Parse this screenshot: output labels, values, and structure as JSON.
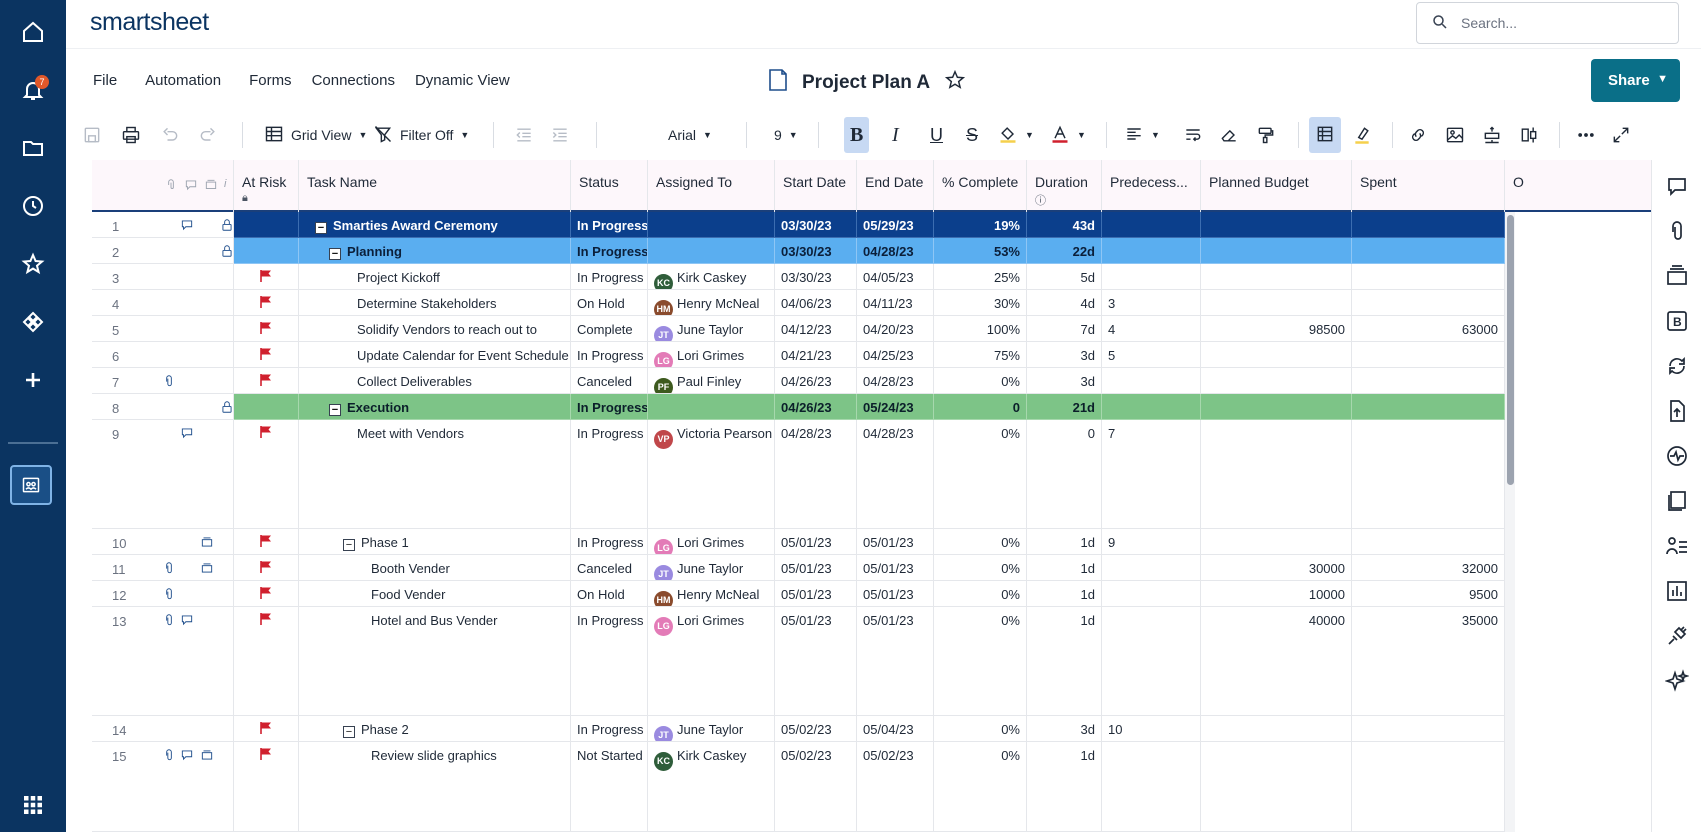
{
  "app": {
    "logo": "smartsheet",
    "notification_count": "7"
  },
  "search": {
    "placeholder": "Search..."
  },
  "menu": {
    "file": "File",
    "automation": "Automation",
    "forms": "Forms",
    "connections": "Connections",
    "dynamic_view": "Dynamic View"
  },
  "sheet": {
    "title": "Project Plan A"
  },
  "share": {
    "label": "Share"
  },
  "toolbar": {
    "view": "Grid View",
    "filter": "Filter Off",
    "font": "Arial",
    "font_size": "9"
  },
  "columns": {
    "at_risk": "At Risk",
    "task_name": "Task Name",
    "status": "Status",
    "assigned_to": "Assigned To",
    "start_date": "Start Date",
    "end_date": "End Date",
    "pct_complete": "% Complete",
    "duration": "Duration",
    "predecessors": "Predecess...",
    "planned_budget": "Planned Budget",
    "spent": "Spent",
    "overflow": "O"
  },
  "rows": [
    {
      "num": "1",
      "name": "Smarties Award Ceremony",
      "status": "In Progress",
      "assignee": "",
      "initials": "",
      "start": "03/30/23",
      "end": "05/29/23",
      "pct": "19%",
      "dur": "43d",
      "pred": "",
      "budget": "",
      "spent": ""
    },
    {
      "num": "2",
      "name": "Planning",
      "status": "In Progress",
      "assignee": "",
      "initials": "",
      "start": "03/30/23",
      "end": "04/28/23",
      "pct": "53%",
      "dur": "22d",
      "pred": "",
      "budget": "",
      "spent": ""
    },
    {
      "num": "3",
      "name": "Project Kickoff",
      "status": "In Progress",
      "assignee": "Kirk Caskey",
      "initials": "KC",
      "start": "03/30/23",
      "end": "04/05/23",
      "pct": "25%",
      "dur": "5d",
      "pred": "",
      "budget": "",
      "spent": ""
    },
    {
      "num": "4",
      "name": "Determine Stakeholders",
      "status": "On Hold",
      "assignee": "Henry McNeal",
      "initials": "HM",
      "start": "04/06/23",
      "end": "04/11/23",
      "pct": "30%",
      "dur": "4d",
      "pred": "3",
      "budget": "",
      "spent": ""
    },
    {
      "num": "5",
      "name": "Solidify Vendors to reach out to",
      "status": "Complete",
      "assignee": "June Taylor",
      "initials": "JT",
      "start": "04/12/23",
      "end": "04/20/23",
      "pct": "100%",
      "dur": "7d",
      "pred": "4",
      "budget": "98500",
      "spent": "63000"
    },
    {
      "num": "6",
      "name": "Update Calendar for Event Schedule",
      "status": "In Progress",
      "assignee": "Lori Grimes",
      "initials": "LG",
      "start": "04/21/23",
      "end": "04/25/23",
      "pct": "75%",
      "dur": "3d",
      "pred": "5",
      "budget": "",
      "spent": ""
    },
    {
      "num": "7",
      "name": "Collect Deliverables",
      "status": "Canceled",
      "assignee": "Paul Finley",
      "initials": "PF",
      "start": "04/26/23",
      "end": "04/28/23",
      "pct": "0%",
      "dur": "3d",
      "pred": "",
      "budget": "",
      "spent": ""
    },
    {
      "num": "8",
      "name": "Execution",
      "status": "In Progress",
      "assignee": "",
      "initials": "",
      "start": "04/26/23",
      "end": "05/24/23",
      "pct": "0",
      "dur": "21d",
      "pred": "",
      "budget": "",
      "spent": ""
    },
    {
      "num": "9",
      "name": "Meet with Vendors",
      "status": "In Progress",
      "assignee": "Victoria Pearson",
      "initials": "VP",
      "start": "04/28/23",
      "end": "04/28/23",
      "pct": "0%",
      "dur": "0",
      "pred": "7",
      "budget": "",
      "spent": ""
    },
    {
      "num": "10",
      "name": "Phase 1",
      "status": "In Progress",
      "assignee": "Lori Grimes",
      "initials": "LG",
      "start": "05/01/23",
      "end": "05/01/23",
      "pct": "0%",
      "dur": "1d",
      "pred": "9",
      "budget": "",
      "spent": ""
    },
    {
      "num": "11",
      "name": "Booth Vender",
      "status": "Canceled",
      "assignee": "June Taylor",
      "initials": "JT",
      "start": "05/01/23",
      "end": "05/01/23",
      "pct": "0%",
      "dur": "1d",
      "pred": "",
      "budget": "30000",
      "spent": "32000"
    },
    {
      "num": "12",
      "name": "Food Vender",
      "status": "On Hold",
      "assignee": "Henry McNeal",
      "initials": "HM",
      "start": "05/01/23",
      "end": "05/01/23",
      "pct": "0%",
      "dur": "1d",
      "pred": "",
      "budget": "10000",
      "spent": "9500"
    },
    {
      "num": "13",
      "name": "Hotel and Bus Vender",
      "status": "In Progress",
      "assignee": "Lori Grimes",
      "initials": "LG",
      "start": "05/01/23",
      "end": "05/01/23",
      "pct": "0%",
      "dur": "1d",
      "pred": "",
      "budget": "40000",
      "spent": "35000"
    },
    {
      "num": "14",
      "name": "Phase 2",
      "status": "In Progress",
      "assignee": "June Taylor",
      "initials": "JT",
      "start": "05/02/23",
      "end": "05/04/23",
      "pct": "0%",
      "dur": "3d",
      "pred": "10",
      "budget": "",
      "spent": ""
    },
    {
      "num": "15",
      "name": "Review slide graphics",
      "status": "Not Started",
      "assignee": "Kirk Caskey",
      "initials": "KC",
      "start": "05/02/23",
      "end": "05/02/23",
      "pct": "0%",
      "dur": "1d",
      "pred": "",
      "budget": "",
      "spent": ""
    }
  ],
  "colors": {
    "nav_bg": "#0b3461",
    "share_bg": "#0a6f88",
    "level0": "#0b3f8c",
    "level1": "#5aaef0",
    "execution": "#7dc487",
    "flag": "#d0202e"
  }
}
